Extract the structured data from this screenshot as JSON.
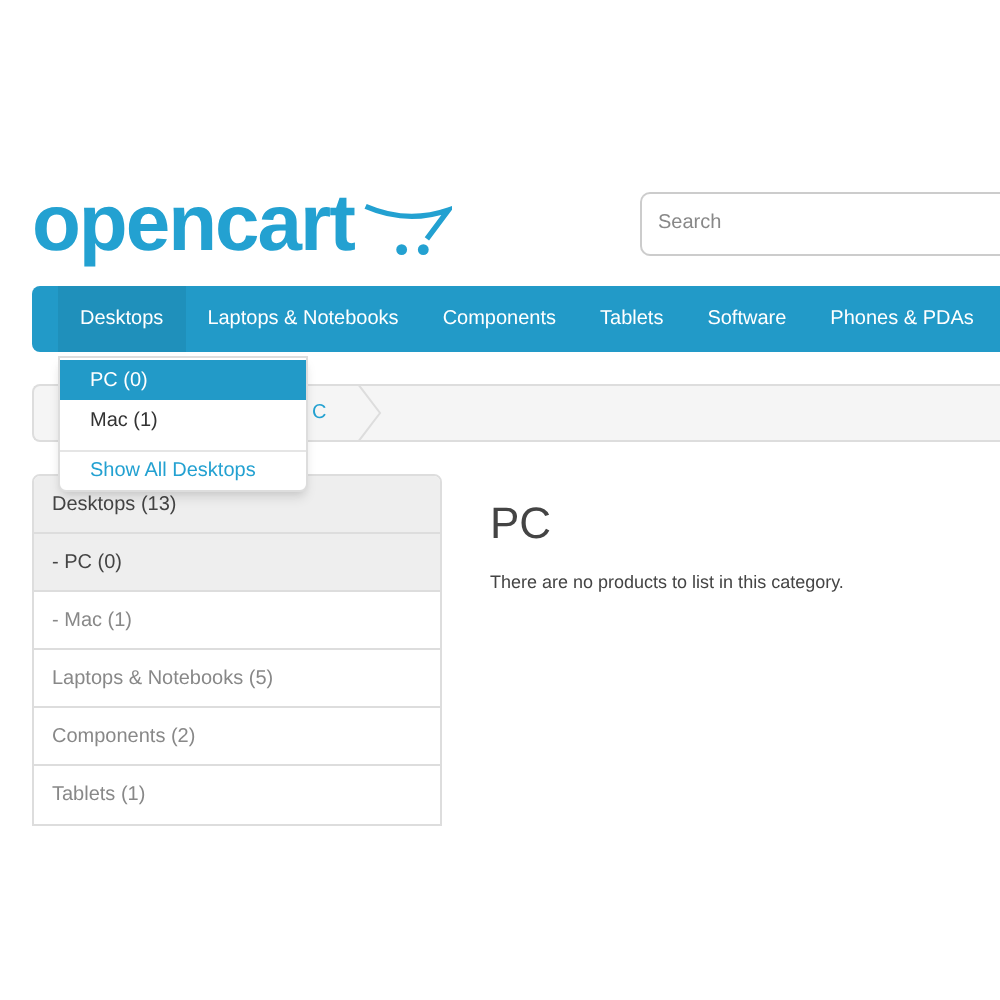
{
  "logo": {
    "text": "opencart"
  },
  "search": {
    "placeholder": "Search"
  },
  "nav": [
    {
      "label": "Desktops",
      "selected": true
    },
    {
      "label": "Laptops & Notebooks",
      "selected": false
    },
    {
      "label": "Components",
      "selected": false
    },
    {
      "label": "Tablets",
      "selected": false
    },
    {
      "label": "Software",
      "selected": false
    },
    {
      "label": "Phones & PDAs",
      "selected": false
    }
  ],
  "dropdown": {
    "items": [
      {
        "label": "PC (0)",
        "selected": true
      },
      {
        "label": "Mac (1)",
        "selected": false
      }
    ],
    "show_all": "Show All Desktops"
  },
  "breadcrumb": {
    "last": "C"
  },
  "sidebar": [
    {
      "label": "Desktops (13)",
      "selected": true
    },
    {
      "label": "- PC (0)",
      "selected": true
    },
    {
      "label": "- Mac (1)",
      "selected": false
    },
    {
      "label": "Laptops & Notebooks (5)",
      "selected": false
    },
    {
      "label": "Components (2)",
      "selected": false
    },
    {
      "label": "Tablets (1)",
      "selected": false
    }
  ],
  "content": {
    "title": "PC",
    "message": "There are no products to list in this category."
  }
}
